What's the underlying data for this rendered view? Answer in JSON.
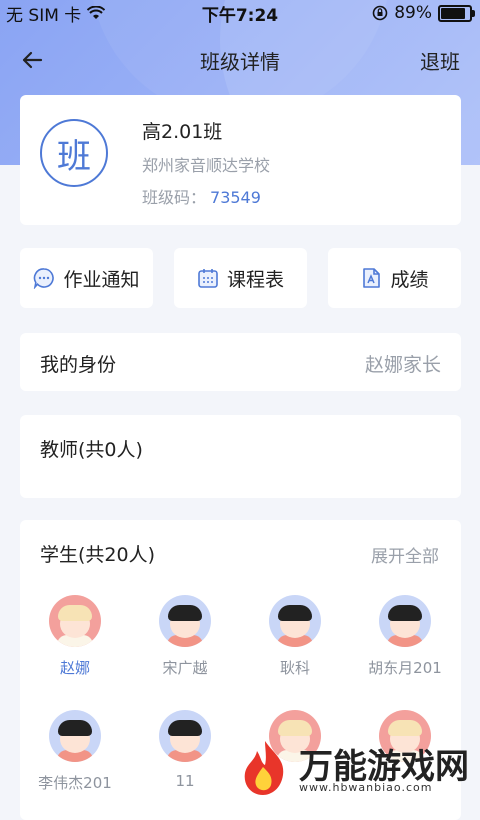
{
  "status_bar": {
    "carrier": "无 SIM 卡",
    "time": "下午7:24",
    "battery": "89%"
  },
  "nav": {
    "title": "班级详情",
    "exit_label": "退班"
  },
  "class_info": {
    "logo_char": "班",
    "name": "高2.01班",
    "school": "郑州家音顺达学校",
    "code_label": "班级码：",
    "code_value": "73549"
  },
  "quick_actions": [
    {
      "label": "作业通知",
      "icon": "message-bubble-icon"
    },
    {
      "label": "课程表",
      "icon": "calendar-icon"
    },
    {
      "label": "成绩",
      "icon": "document-icon"
    }
  ],
  "identity": {
    "label": "我的身份",
    "value": "赵娜家长"
  },
  "teachers": {
    "label": "教师(共0人)"
  },
  "students": {
    "label": "学生(共20人)",
    "expand_label": "展开全部",
    "list": [
      {
        "name": "赵娜",
        "avatar": "girl"
      },
      {
        "name": "宋广越",
        "avatar": "boy"
      },
      {
        "name": "耿科",
        "avatar": "boy"
      },
      {
        "name": "胡东月201",
        "avatar": "boy"
      },
      {
        "name": "李伟杰201",
        "avatar": "boy"
      },
      {
        "name": "11",
        "avatar": "boy"
      },
      {
        "name": "",
        "avatar": "girl"
      },
      {
        "name": "",
        "avatar": "girl"
      }
    ]
  },
  "watermark": {
    "text": "万能游戏网",
    "url": "www.hbwanbiao.com"
  },
  "colors": {
    "accent": "#4e79d6",
    "hero": "#8aa4f3",
    "muted": "#9aa0aa"
  }
}
